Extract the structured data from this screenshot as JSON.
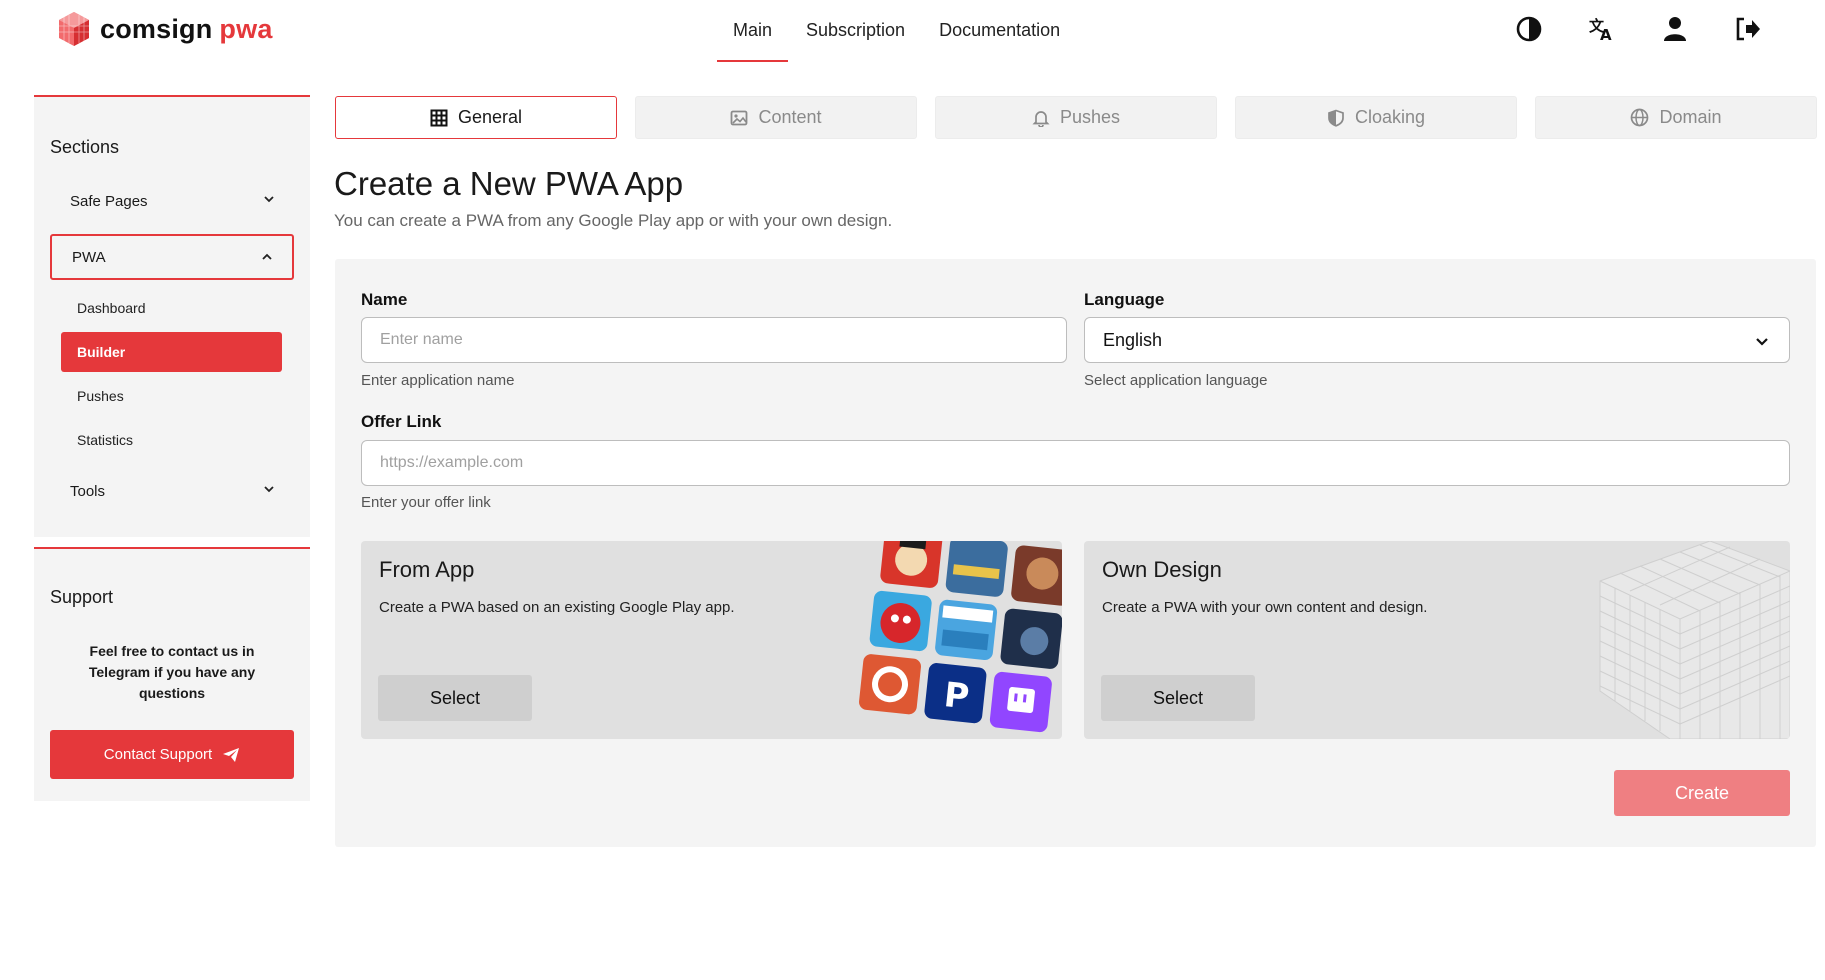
{
  "brand": {
    "name_part1": "comsign",
    "name_part2": "pwa",
    "accent_color": "#e5383b"
  },
  "topnav": {
    "items": [
      {
        "label": "Main",
        "active": true
      },
      {
        "label": "Subscription",
        "active": false
      },
      {
        "label": "Documentation",
        "active": false
      }
    ],
    "icons": [
      "contrast-icon",
      "translate-icon",
      "user-icon",
      "logout-icon"
    ]
  },
  "sidebar": {
    "sections_title": "Sections",
    "groups": [
      {
        "label": "Safe Pages",
        "expanded": false
      },
      {
        "label": "PWA",
        "expanded": true
      },
      {
        "label": "Tools",
        "expanded": false
      }
    ],
    "pwa_items": [
      {
        "label": "Dashboard",
        "active": false
      },
      {
        "label": "Builder",
        "active": true
      },
      {
        "label": "Pushes",
        "active": false
      },
      {
        "label": "Statistics",
        "active": false
      }
    ],
    "support_title": "Support",
    "support_text": "Feel free to contact us in Telegram if you have any questions",
    "support_button": "Contact Support"
  },
  "tabs": [
    {
      "label": "General",
      "icon": "grid-icon",
      "active": true
    },
    {
      "label": "Content",
      "icon": "image-icon",
      "active": false
    },
    {
      "label": "Pushes",
      "icon": "bell-icon",
      "active": false
    },
    {
      "label": "Cloaking",
      "icon": "shield-icon",
      "active": false
    },
    {
      "label": "Domain",
      "icon": "globe-icon",
      "active": false
    }
  ],
  "main": {
    "title": "Create a New PWA App",
    "subtitle": "You can create a PWA from any Google Play app or with your own design."
  },
  "form": {
    "name_label": "Name",
    "name_placeholder": "Enter name",
    "name_value": "",
    "name_hint": "Enter application name",
    "language_label": "Language",
    "language_value": "English",
    "language_hint": "Select application language",
    "offer_label": "Offer Link",
    "offer_placeholder": "https://example.com",
    "offer_value": "",
    "offer_hint": "Enter your offer link"
  },
  "options": [
    {
      "title": "From App",
      "description": "Create a PWA based on an existing Google Play app.",
      "button": "Select",
      "art": "app-icons-collage"
    },
    {
      "title": "Own Design",
      "description": "Create a PWA with your own content and design.",
      "button": "Select",
      "art": "wireframe-cube"
    }
  ],
  "create_button": "Create"
}
